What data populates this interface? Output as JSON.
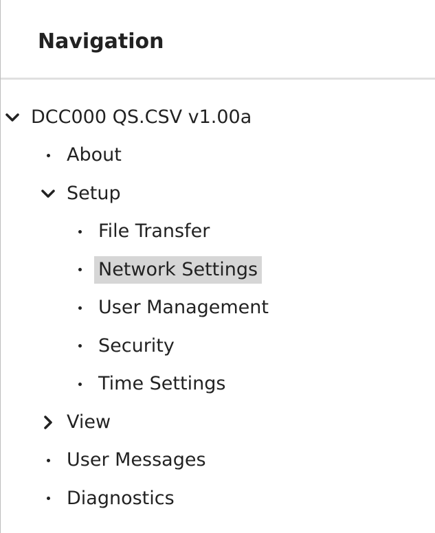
{
  "navigation": {
    "title": "Navigation",
    "selected_label": "Network Settings",
    "selected_color": "#d6d6d6",
    "icons": {
      "expanded": "chevron-down-icon",
      "collapsed": "chevron-right-icon",
      "leaf": "bullet-icon"
    },
    "tree": {
      "root": "DCC000 QS.CSV v1.00a",
      "about": "About",
      "setup": "Setup",
      "file_transfer": "File Transfer",
      "network_settings": "Network Settings",
      "user_management": "User Management",
      "security": "Security",
      "time_settings": "Time Settings",
      "view": "View",
      "user_messages": "User Messages",
      "diagnostics": "Diagnostics"
    }
  }
}
